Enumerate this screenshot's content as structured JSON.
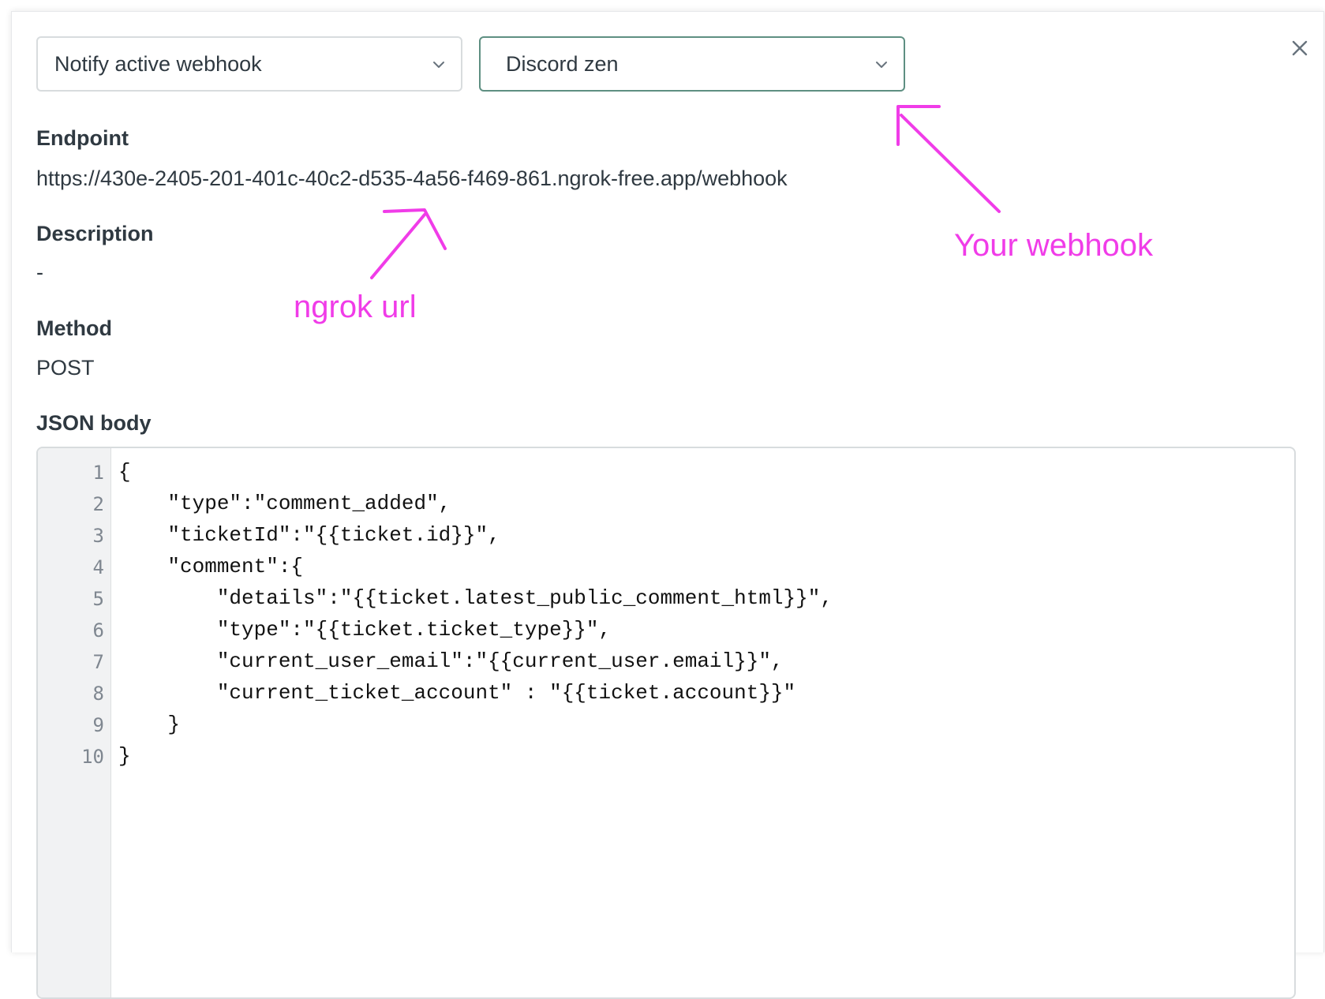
{
  "dropdowns": {
    "action": "Notify active webhook",
    "webhook": "Discord zen"
  },
  "fields": {
    "endpoint_label": "Endpoint",
    "endpoint_value": "https://430e-2405-201-401c-40c2-d535-4a56-f469-861.ngrok-free.app/webhook",
    "description_label": "Description",
    "description_value": "-",
    "method_label": "Method",
    "method_value": "POST",
    "json_label": "JSON body"
  },
  "json_body": {
    "line_numbers": [
      "1",
      "2",
      "3",
      "4",
      "5",
      "6",
      "7",
      "8",
      "9",
      "10"
    ],
    "lines": [
      "{",
      "    \"type\":\"comment_added\",",
      "    \"ticketId\":\"{{ticket.id}}\",",
      "    \"comment\":{",
      "        \"details\":\"{{ticket.latest_public_comment_html}}\",",
      "        \"type\":\"{{ticket.ticket_type}}\",",
      "        \"current_user_email\":\"{{current_user.email}}\",",
      "        \"current_ticket_account\" : \"{{ticket.account}}\"",
      "    }",
      "}"
    ]
  },
  "annotations": {
    "ngrok": "ngrok url",
    "webhook": "Your webhook",
    "color": "#f03ce8"
  },
  "icons": {
    "close": "close-icon",
    "chevron": "chevron-down-icon"
  }
}
